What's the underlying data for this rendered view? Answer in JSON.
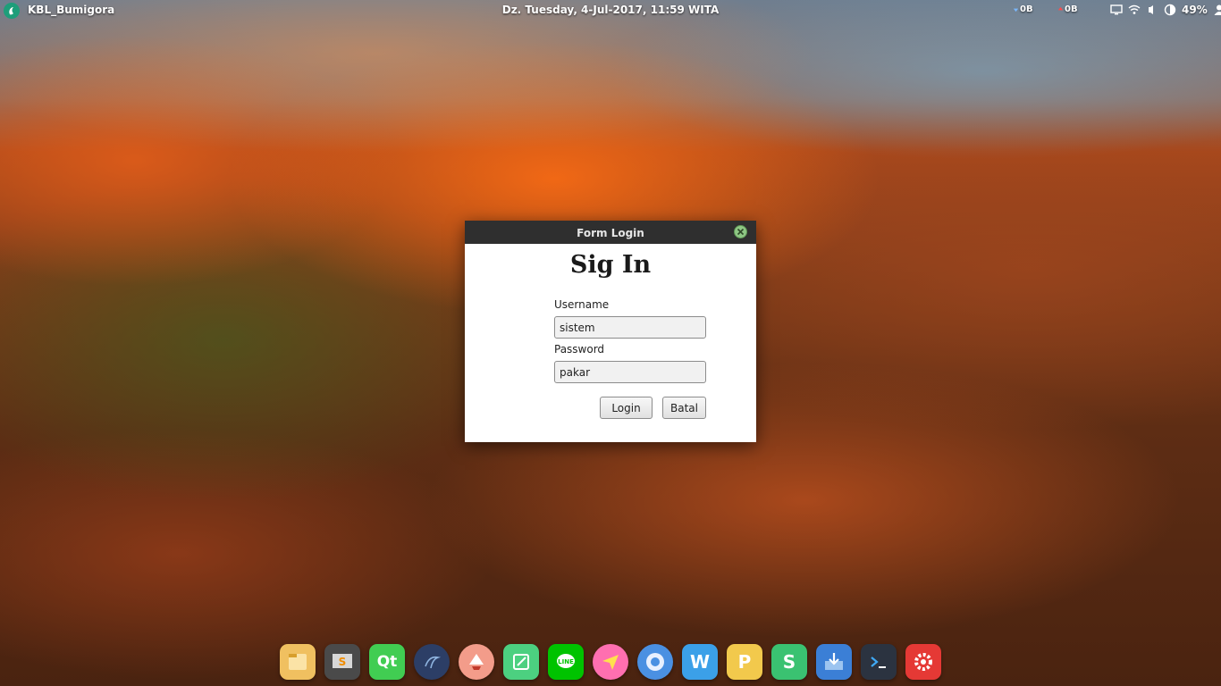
{
  "top_panel": {
    "app_name": "KBL_Bumigora",
    "clock": "Dz. Tuesday,  4-Jul-2017, 11:59 WITA",
    "net_down": "0B",
    "net_up": "0B",
    "battery_percent": "49%"
  },
  "dialog": {
    "title": "Form Login",
    "heading": "Sig In",
    "username_label": "Username",
    "username_value": "sistem",
    "password_label": "Password",
    "password_value": "pakar",
    "login_button": "Login",
    "cancel_button": "Batal"
  },
  "dock": {
    "apps": [
      {
        "icon": "file-manager-icon",
        "color": "#f0c060"
      },
      {
        "icon": "sublime-text-icon",
        "color": "#4a4a4a"
      },
      {
        "icon": "qt-creator-icon",
        "color": "#41cd52"
      },
      {
        "icon": "mysql-workbench-icon",
        "color": "#2c3e66"
      },
      {
        "icon": "inkscape-icon",
        "color": "#f39c8a"
      },
      {
        "icon": "text-editor-icon",
        "color": "#4cd080"
      },
      {
        "icon": "line-messenger-icon",
        "color": "#00c300"
      },
      {
        "icon": "send-anywhere-icon",
        "color": "#ff6fb0"
      },
      {
        "icon": "chromium-icon",
        "color": "#4a90e2"
      },
      {
        "icon": "wps-writer-icon",
        "color": "#3ba0e8"
      },
      {
        "icon": "wps-presentation-icon",
        "color": "#f2c94c"
      },
      {
        "icon": "wps-spreadsheets-icon",
        "color": "#3ac271"
      },
      {
        "icon": "downloader-icon",
        "color": "#3b7fd6"
      },
      {
        "icon": "terminal-icon",
        "color": "#2b3340"
      },
      {
        "icon": "settings-icon",
        "color": "#e53935"
      }
    ]
  }
}
